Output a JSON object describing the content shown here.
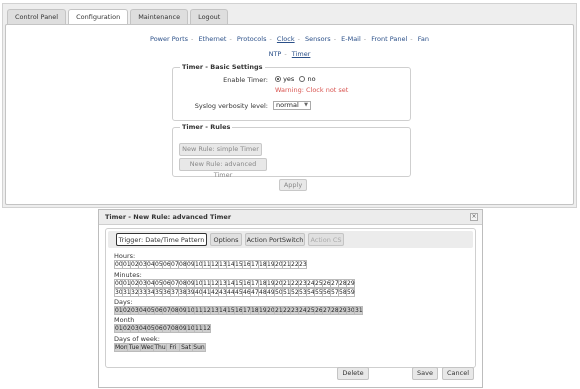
{
  "top_tabs": [
    "Control Panel",
    "Configuration",
    "Maintenance",
    "Logout"
  ],
  "nav1": [
    "Power Ports",
    "Ethernet",
    "Protocols",
    "Clock",
    "Sensors",
    "E-Mail",
    "Front Panel",
    "Fan"
  ],
  "nav2": [
    "NTP",
    "Timer"
  ],
  "basic": {
    "legend": "Timer - Basic Settings",
    "enable_label": "Enable Timer:",
    "yes": "yes",
    "no": "no",
    "warning": "Warning: Clock not set",
    "syslog_label": "Syslog verbosity level:",
    "syslog_value": "normal"
  },
  "rules": {
    "legend": "Timer - Rules",
    "simple_btn": "New Rule: simple Timer",
    "advanced_btn": "New Rule: advanced Timer"
  },
  "apply_label": "Apply",
  "dialog": {
    "title": "Timer - New Rule: advanced Timer",
    "close": "×",
    "tabs": [
      "Trigger: Date/Time Pattern",
      "Options",
      "Action PortSwitch",
      "Action CS"
    ],
    "hours_label": "Hours:",
    "minutes_label": "Minutes:",
    "days_label": "Days:",
    "month_label": "Month",
    "dow_label": "Days of week:",
    "dow": [
      "Mon",
      "Tue",
      "Wed",
      "Thu",
      "Fri",
      "Sat",
      "Sun"
    ],
    "delete_label": "Delete",
    "save_label": "Save",
    "cancel_label": "Cancel"
  },
  "colors": {
    "link": "#2a4f88",
    "warning": "#d9534f",
    "selected_cell": "#cfcfcf"
  }
}
